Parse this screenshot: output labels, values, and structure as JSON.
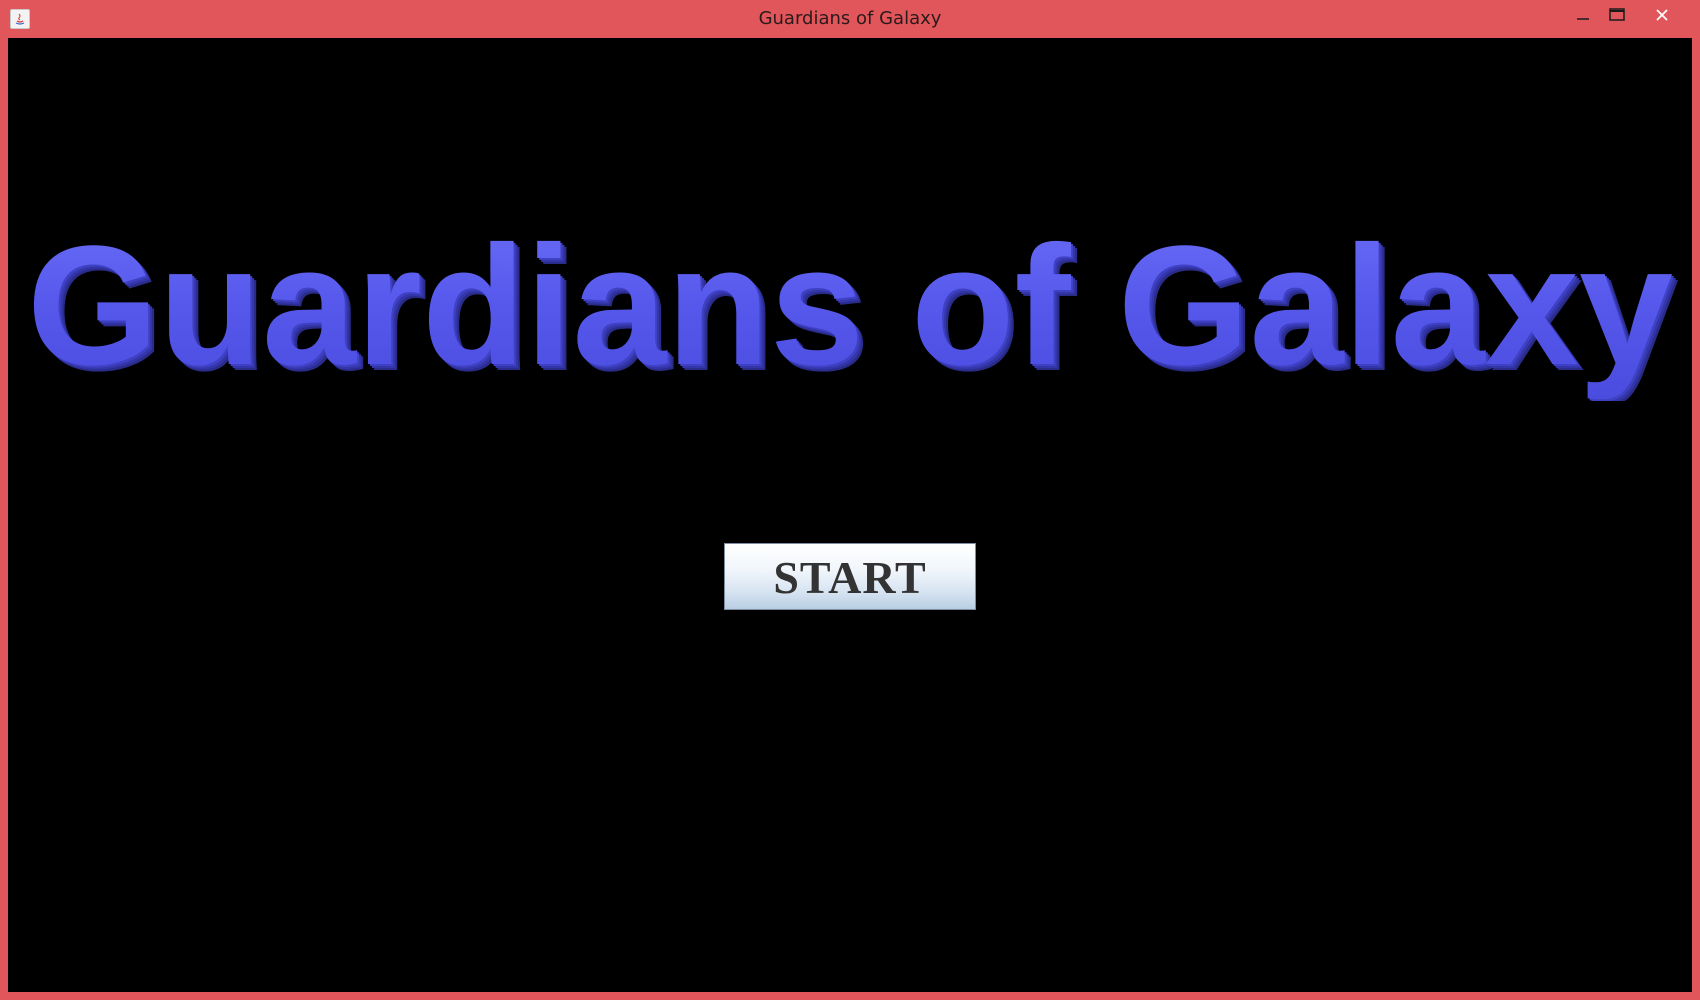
{
  "window": {
    "title": "Guardians of Galaxy",
    "frame_color": "#e0565b",
    "controls": {
      "minimize_icon": "minimize-icon",
      "maximize_icon": "maximize-icon",
      "close_icon": "close-icon"
    },
    "app_icon": "java-app-icon"
  },
  "game": {
    "background_color": "#000000",
    "title_text": "Guardians of Galaxy",
    "title_color": "#5a5cf0",
    "start_label": "START"
  }
}
